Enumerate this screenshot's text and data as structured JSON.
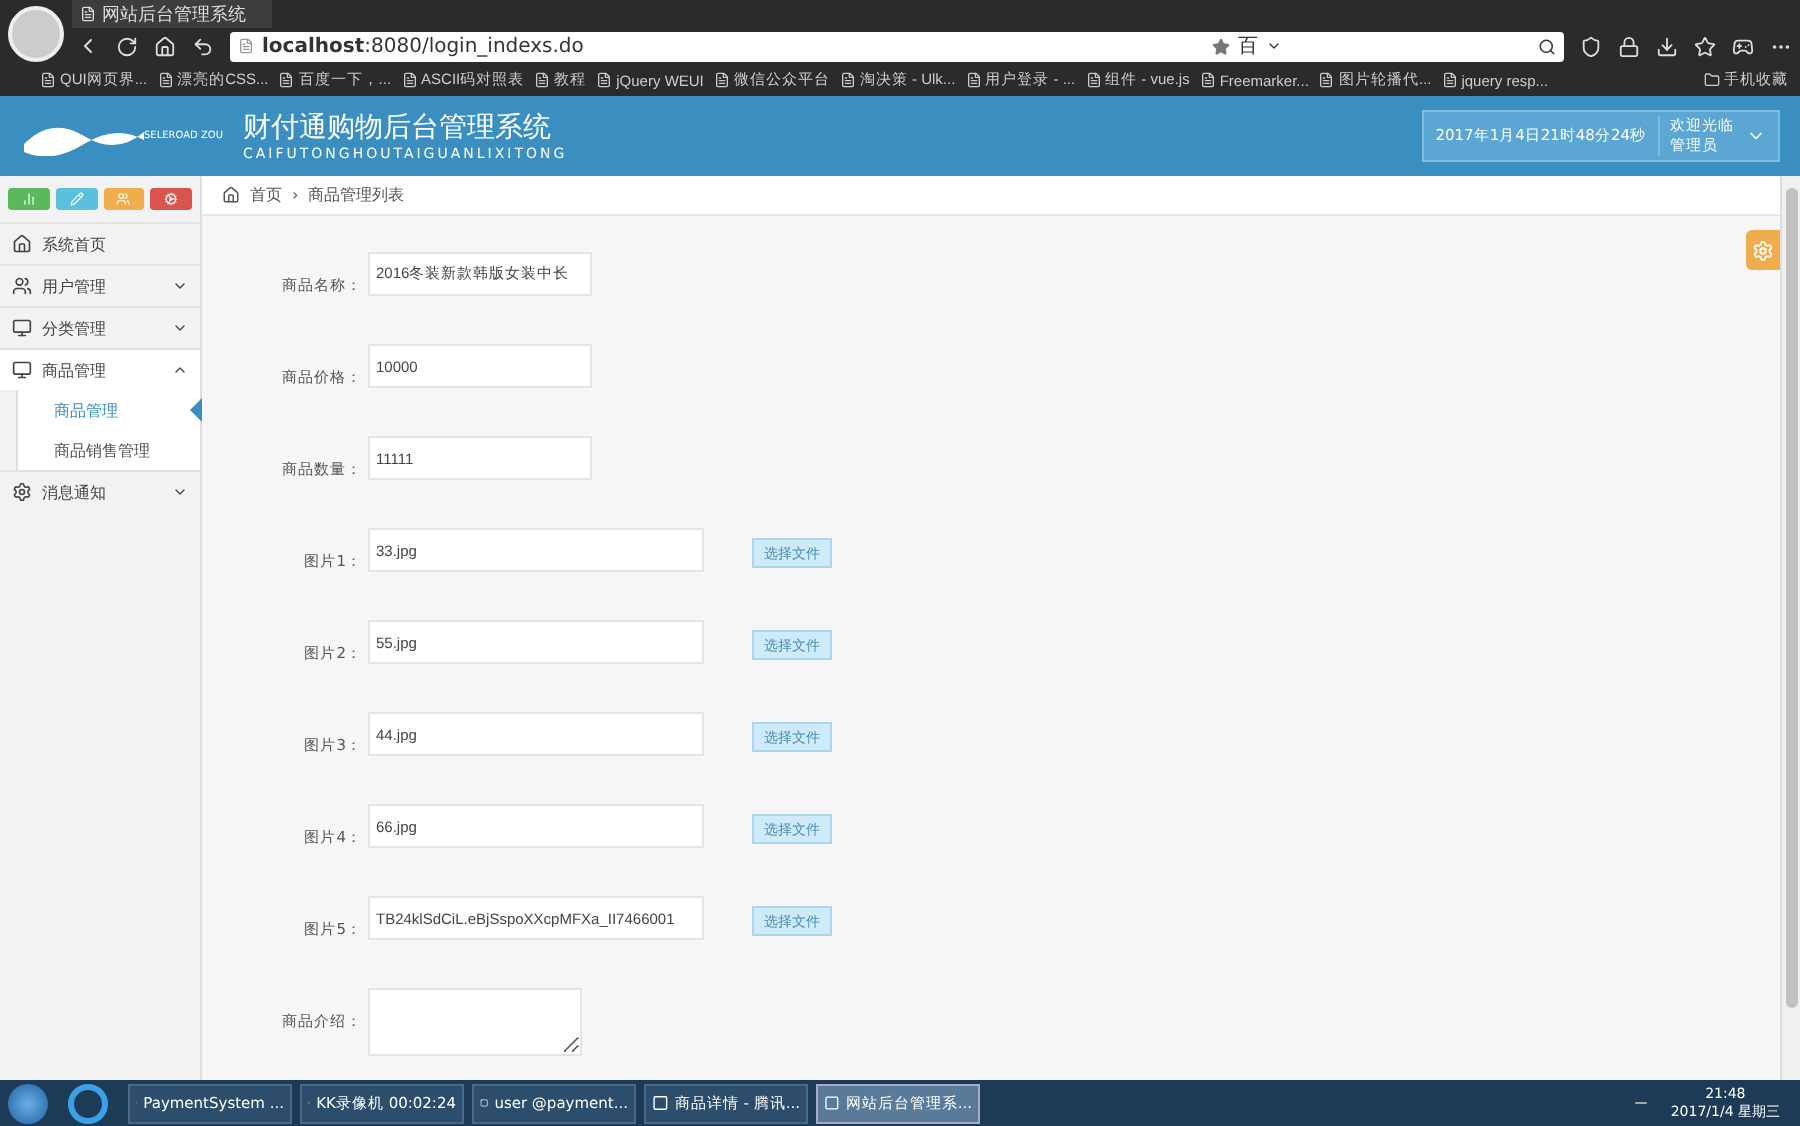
{
  "browser": {
    "tab_title": "网站后台管理系统",
    "url_host": "localhost",
    "url_rest": ":8080/login_indexs.do",
    "search_engine": "百",
    "bookmarks": [
      {
        "label": "QUI网页界..."
      },
      {
        "label": "漂亮的CSS..."
      },
      {
        "label": "百度一下，..."
      },
      {
        "label": "ASCII码对照表"
      },
      {
        "label": "教程"
      },
      {
        "label": "jQuery WEUI"
      },
      {
        "label": "微信公众平台"
      },
      {
        "label": "淘决策 - Ulk..."
      },
      {
        "label": "用户登录 - ..."
      },
      {
        "label": "组件 - vue.js"
      },
      {
        "label": "Freemarker..."
      },
      {
        "label": "图片轮播代..."
      },
      {
        "label": "jquery resp..."
      }
    ],
    "mobile_bookmarks": "手机收藏"
  },
  "header": {
    "logo_text": "SELEROAD ZOU",
    "title": "财付通购物后台管理系统",
    "subtitle": "CAIFUTONGHOUTAIGUANLIXITONG",
    "clock": "2017年1月4日21时48分24秒",
    "welcome": "欢迎光临",
    "user": "管理员"
  },
  "sidebar": {
    "items": [
      {
        "label": "系统首页"
      },
      {
        "label": "用户管理",
        "expanded": false
      },
      {
        "label": "分类管理",
        "expanded": false
      },
      {
        "label": "商品管理",
        "expanded": true,
        "children": [
          {
            "label": "商品管理",
            "selected": true
          },
          {
            "label": "商品销售管理",
            "selected": false
          }
        ]
      },
      {
        "label": "消息通知",
        "expanded": false
      }
    ]
  },
  "breadcrumb": {
    "home": "首页",
    "separator": "›",
    "current": "商品管理列表"
  },
  "form": {
    "fields": [
      {
        "kind": "text",
        "label": "商品名称：",
        "value": "2016冬装新款韩版女装中长"
      },
      {
        "kind": "text",
        "label": "商品价格：",
        "value": "10000"
      },
      {
        "kind": "text",
        "label": "商品数量：",
        "value": "11111"
      },
      {
        "kind": "file",
        "label": "图片1：",
        "value": "33.jpg",
        "button": "选择文件"
      },
      {
        "kind": "file",
        "label": "图片2：",
        "value": "55.jpg",
        "button": "选择文件"
      },
      {
        "kind": "file",
        "label": "图片3：",
        "value": "44.jpg",
        "button": "选择文件"
      },
      {
        "kind": "file",
        "label": "图片4：",
        "value": "66.jpg",
        "button": "选择文件"
      },
      {
        "kind": "file",
        "label": "图片5：",
        "value": "TB24klSdCiL.eBjSspoXXcpMFXa_II7466001",
        "button": "选择文件"
      },
      {
        "kind": "textarea",
        "label": "商品介绍："
      }
    ]
  },
  "taskbar": {
    "windows": [
      {
        "label": "PaymentSystem ...",
        "selected": false
      },
      {
        "label": "KK录像机 00:02:24",
        "selected": false
      },
      {
        "label": "user @payment...",
        "selected": false
      },
      {
        "label": "商品详情 - 腾讯...",
        "selected": false
      },
      {
        "label": "网站后台管理系...",
        "selected": true
      }
    ],
    "time": "21:48",
    "date": "2017/1/4 星期三"
  }
}
